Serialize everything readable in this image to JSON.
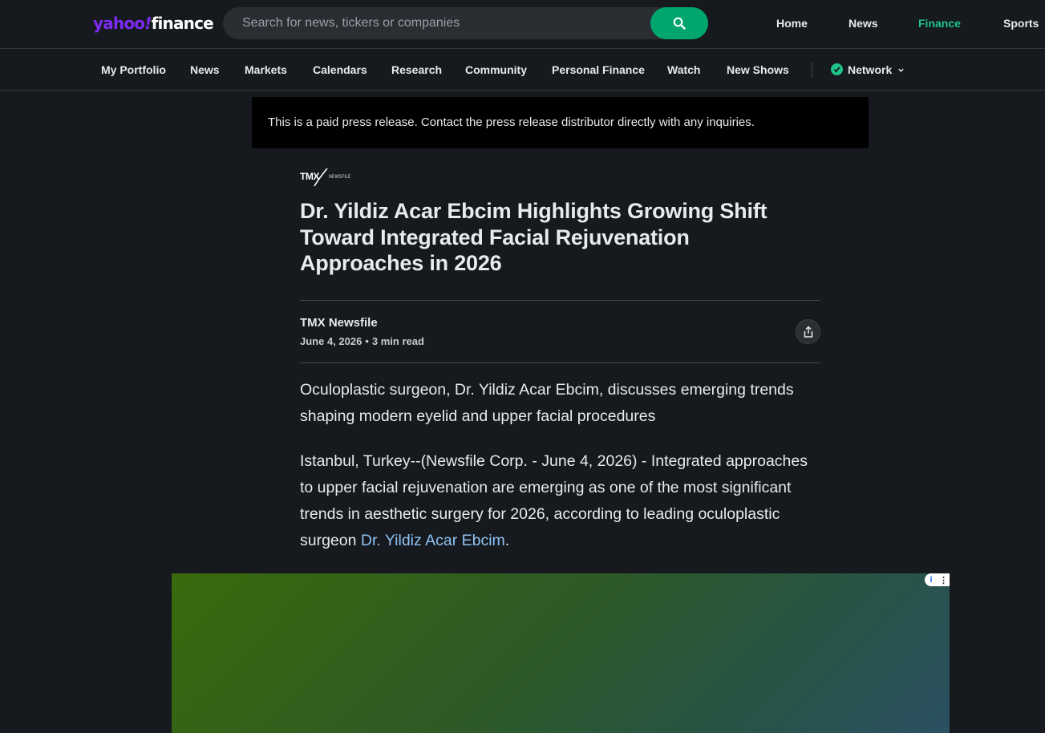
{
  "header": {
    "logo": {
      "brand": "yahoo",
      "bang": "!",
      "product": "finance"
    },
    "search": {
      "placeholder": "Search for news, tickers or companies",
      "value": ""
    },
    "top_nav": [
      {
        "label": "Home"
      },
      {
        "label": "News"
      },
      {
        "label": "Finance",
        "active": true
      },
      {
        "label": "Sports"
      }
    ]
  },
  "sub_nav": {
    "items": [
      {
        "label": "My Portfolio"
      },
      {
        "label": "News"
      },
      {
        "label": "Markets"
      },
      {
        "label": "Calendars"
      },
      {
        "label": "Research"
      },
      {
        "label": "Community"
      },
      {
        "label": "Personal Finance"
      },
      {
        "label": "Watch"
      },
      {
        "label": "New Shows"
      }
    ],
    "network_label": "Network"
  },
  "notice": {
    "text": "This is a paid press release. Contact the press release distributor directly with any inquiries."
  },
  "article": {
    "provider_logo": {
      "mark": "TMX",
      "sub": "NEWSFILE"
    },
    "headline": "Dr. Yildiz Acar Ebcim Highlights Growing Shift Toward Integrated Facial Rejuvenation Approaches in 2026",
    "author": "TMX Newsfile",
    "date": "June 4, 2026",
    "separator": "•",
    "read_time": "3 min read",
    "paragraphs": [
      {
        "text": "Oculoplastic surgeon, Dr. Yildiz Acar Ebcim, discusses emerging trends shaping modern eyelid and upper facial procedures"
      },
      {
        "text": "Istanbul, Turkey--(Newsfile Corp. - June 4, 2026) - Integrated approaches to upper facial rejuvenation are emerging as one of the most significant trends in aesthetic surgery for 2026, according to leading oculoplastic surgeon ",
        "link": "Dr. Yildiz Acar Ebcim",
        "after": "."
      }
    ]
  },
  "ad": {
    "info_glyph": "i",
    "more_glyph": "⋮",
    "colors": {
      "start": "#3a6a0c",
      "end": "#2b5062"
    }
  },
  "colors": {
    "background": "#16191d",
    "accent_green": "#1ec38a",
    "search_button": "#00a66e",
    "brand_purple": "#7b2bf2",
    "link_blue": "#8ec3f5"
  }
}
